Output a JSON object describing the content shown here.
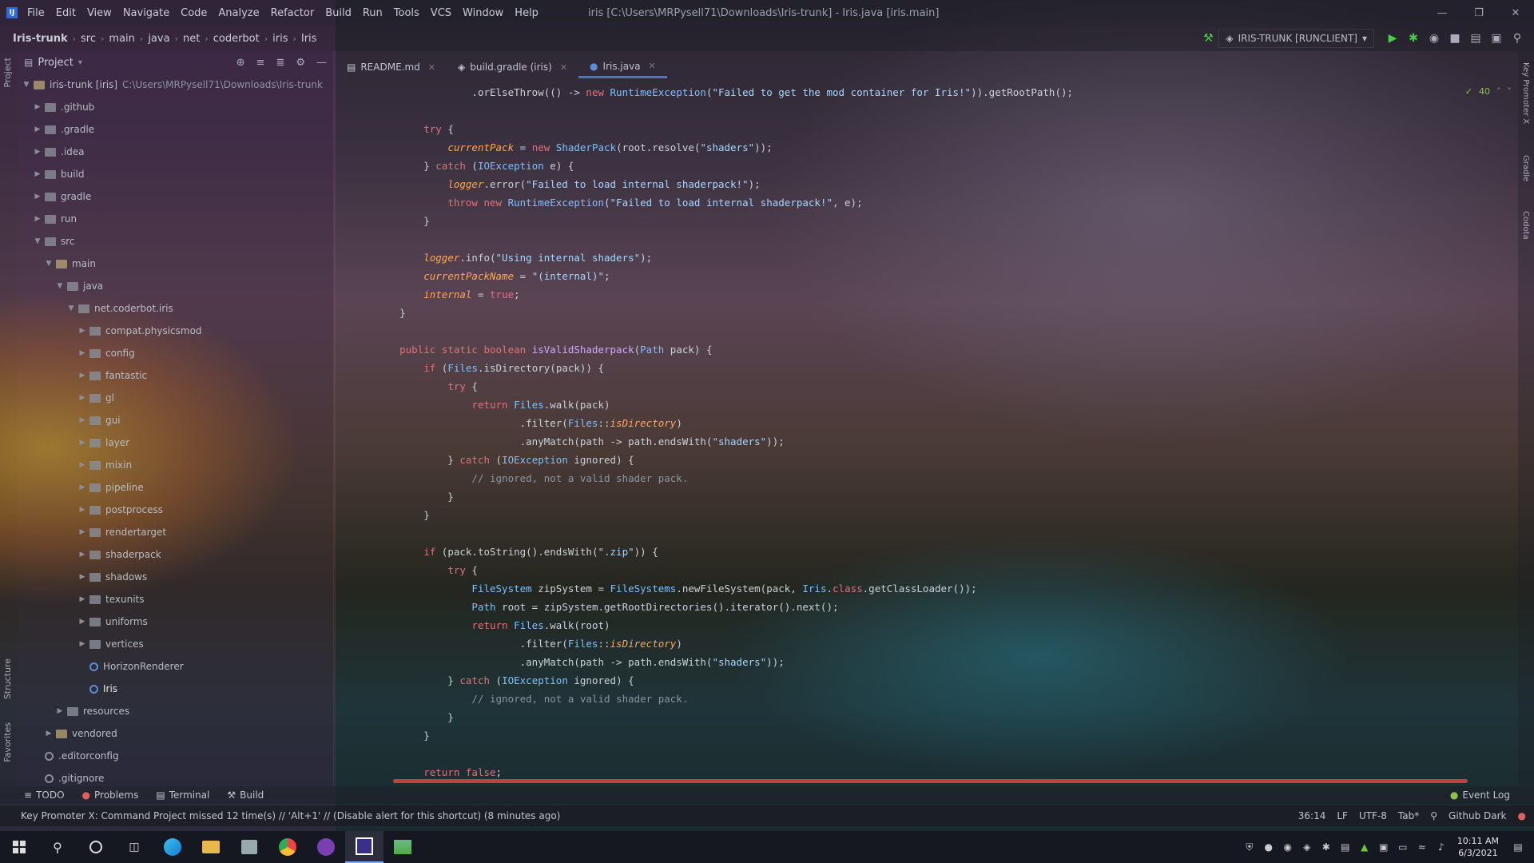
{
  "app": {
    "menu": [
      "File",
      "Edit",
      "View",
      "Navigate",
      "Code",
      "Analyze",
      "Refactor",
      "Build",
      "Run",
      "Tools",
      "VCS",
      "Window",
      "Help"
    ],
    "title": "iris [C:\\Users\\MRPysell71\\Downloads\\Iris-trunk] - Iris.java [iris.main]"
  },
  "breadcrumbs": [
    "Iris-trunk",
    "src",
    "main",
    "java",
    "net",
    "coderbot",
    "iris",
    "Iris"
  ],
  "run_config": "IRIS-TRUNK [RUNCLIENT]",
  "project_panel": {
    "title": "Project",
    "root": "iris-trunk [iris]",
    "root_path": "C:\\Users\\MRPysell71\\Downloads\\Iris-trunk",
    "items": [
      {
        "label": ".github",
        "depth": 1,
        "kind": "folder"
      },
      {
        "label": ".gradle",
        "depth": 1,
        "kind": "folder"
      },
      {
        "label": ".idea",
        "depth": 1,
        "kind": "folder"
      },
      {
        "label": "build",
        "depth": 1,
        "kind": "folder"
      },
      {
        "label": "gradle",
        "depth": 1,
        "kind": "folder"
      },
      {
        "label": "run",
        "depth": 1,
        "kind": "folder"
      },
      {
        "label": "src",
        "depth": 1,
        "kind": "folder"
      },
      {
        "label": "main",
        "depth": 2,
        "kind": "module"
      },
      {
        "label": "java",
        "depth": 3,
        "kind": "folder"
      },
      {
        "label": "net.coderbot.iris",
        "depth": 4,
        "kind": "folder"
      },
      {
        "label": "compat.physicsmod",
        "depth": 5,
        "kind": "folder"
      },
      {
        "label": "config",
        "depth": 5,
        "kind": "folder"
      },
      {
        "label": "fantastic",
        "depth": 5,
        "kind": "folder"
      },
      {
        "label": "gl",
        "depth": 5,
        "kind": "folder"
      },
      {
        "label": "gui",
        "depth": 5,
        "kind": "folder"
      },
      {
        "label": "layer",
        "depth": 5,
        "kind": "folder"
      },
      {
        "label": "mixin",
        "depth": 5,
        "kind": "folder"
      },
      {
        "label": "pipeline",
        "depth": 5,
        "kind": "folder"
      },
      {
        "label": "postprocess",
        "depth": 5,
        "kind": "folder"
      },
      {
        "label": "rendertarget",
        "depth": 5,
        "kind": "folder"
      },
      {
        "label": "shaderpack",
        "depth": 5,
        "kind": "folder"
      },
      {
        "label": "shadows",
        "depth": 5,
        "kind": "folder"
      },
      {
        "label": "texunits",
        "depth": 5,
        "kind": "folder"
      },
      {
        "label": "uniforms",
        "depth": 5,
        "kind": "folder"
      },
      {
        "label": "vertices",
        "depth": 5,
        "kind": "folder"
      },
      {
        "label": "HorizonRenderer",
        "depth": 5,
        "kind": "class"
      },
      {
        "label": "Iris",
        "depth": 5,
        "kind": "class"
      },
      {
        "label": "resources",
        "depth": 3,
        "kind": "folder"
      },
      {
        "label": "vendored",
        "depth": 2,
        "kind": "module"
      },
      {
        "label": ".editorconfig",
        "depth": 1,
        "kind": "file"
      },
      {
        "label": ".gitignore",
        "depth": 1,
        "kind": "file"
      }
    ]
  },
  "tabs": [
    {
      "label": "README.md",
      "active": false
    },
    {
      "label": "build.gradle (iris)",
      "active": false
    },
    {
      "label": "Iris.java",
      "active": true
    }
  ],
  "inspection_count": "40",
  "left_strip": [
    "Project",
    "Structure",
    "Favorites"
  ],
  "right_strip": [
    "Key Promoter X",
    "Gradle",
    "Codota"
  ],
  "bottom_tools": [
    "TODO",
    "Problems",
    "Terminal",
    "Build"
  ],
  "event_log": "Event Log",
  "status": {
    "message": "Key Promoter X: Command Project missed 12 time(s) // 'Alt+1' // (Disable alert for this shortcut) (8 minutes ago)",
    "position": "36:14",
    "line_sep": "LF",
    "encoding": "UTF-8",
    "indent": "Tab*",
    "theme": "Github Dark"
  },
  "taskbar": {
    "time": "10:11 AM",
    "date": "6/3/2021"
  }
}
